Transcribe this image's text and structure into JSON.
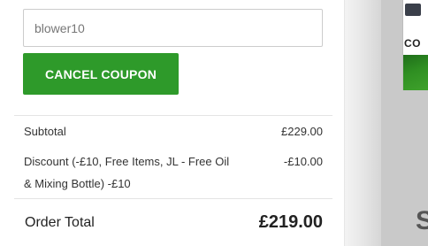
{
  "coupon": {
    "input_value": "blower10",
    "cancel_label": "CANCEL COUPON"
  },
  "totals": {
    "subtotal_label": "Subtotal",
    "subtotal_value": "£229.00",
    "discount_label_line1": "Discount (-£10, Free Items, JL - Free Oil",
    "discount_label_line2": "& Mixing Bottle) -£10",
    "discount_value": "-£10.00",
    "order_total_label": "Order Total",
    "order_total_value": "£219.00"
  },
  "right_panel": {
    "product_label_fragment": "CO",
    "partial_glyph": "S"
  },
  "colors": {
    "button_green": "#2e9a2a",
    "divider": "#e4e4e4",
    "input_border": "#cccccc"
  }
}
